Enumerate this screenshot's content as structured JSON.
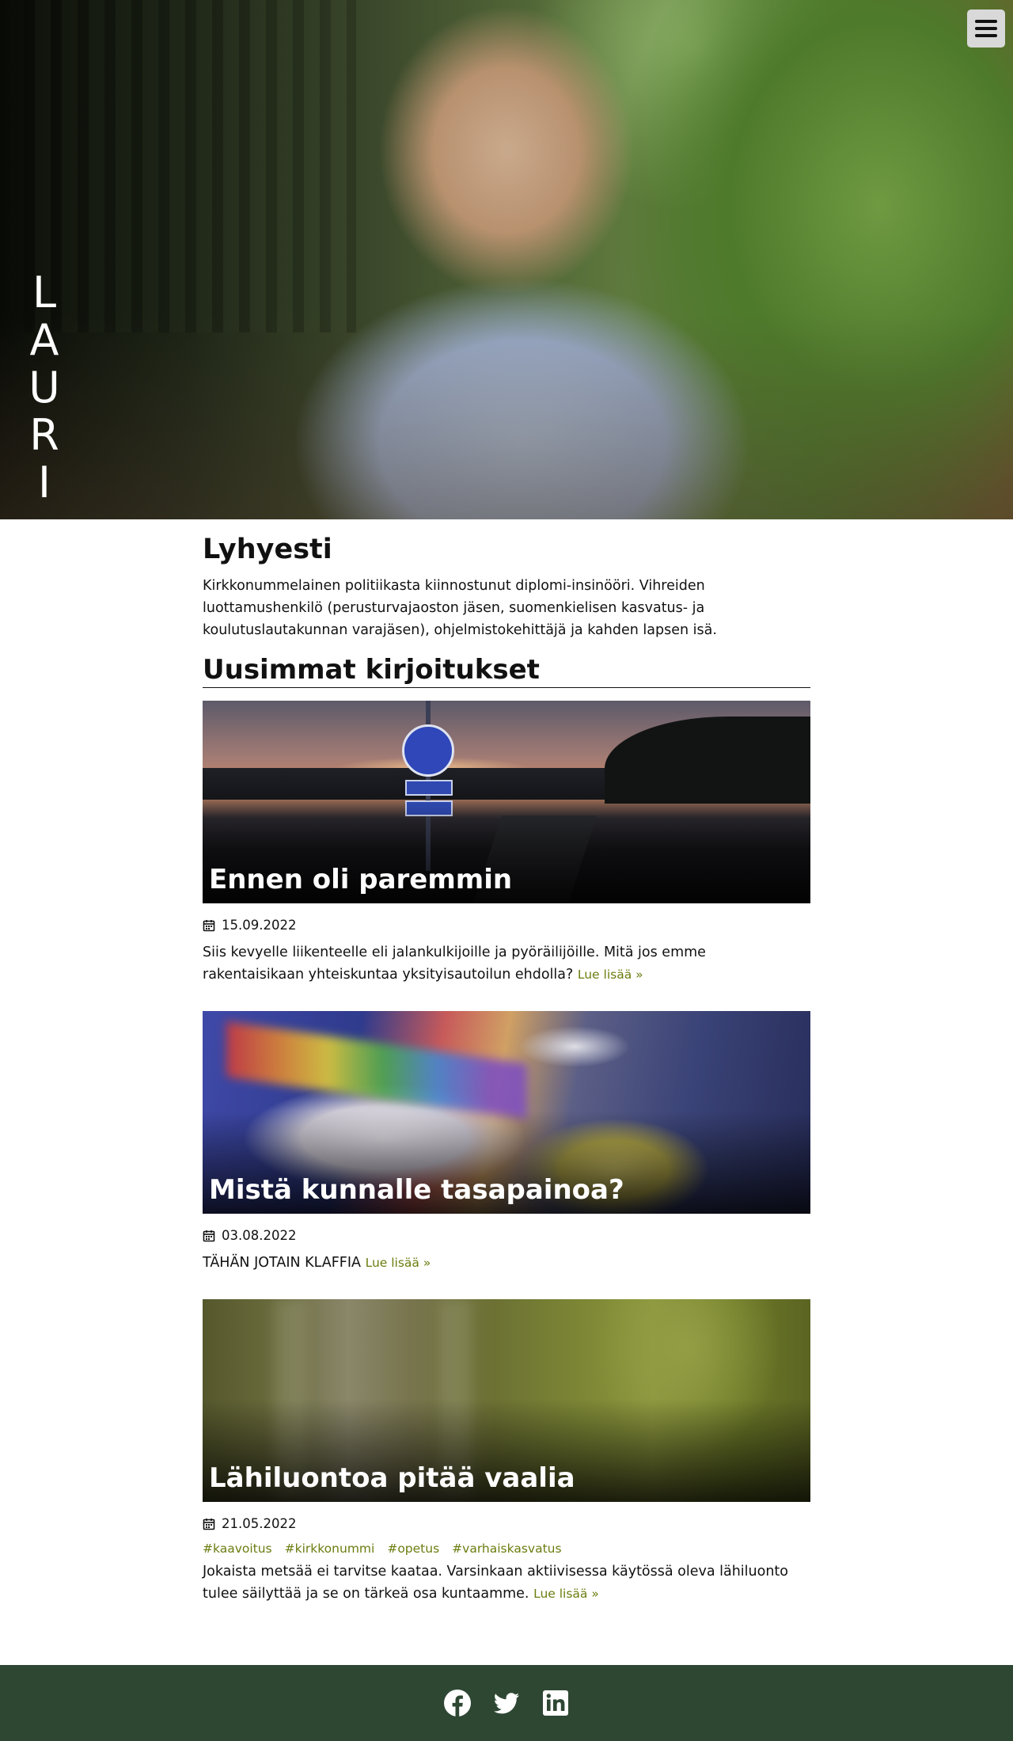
{
  "hero": {
    "name_letters": [
      "L",
      "A",
      "U",
      "R",
      "I"
    ],
    "menu_icon": "hamburger-menu-icon"
  },
  "about": {
    "title": "Lyhyesti",
    "text": "Kirkkonummelainen politiikasta kiinnostunut diplomi-insinööri. Vihreiden luottamushenkilö (perusturvajaoston jäsen, suomenkielisen kasvatus- ja koulutuslautakunnan varajäsen), ohjelmistokehittäjä ja kahden lapsen isä."
  },
  "posts_section": {
    "title": "Uusimmat kirjoitukset"
  },
  "posts": [
    {
      "title": "Ennen oli paremmin",
      "date": "15.09.2022",
      "tags": [],
      "excerpt": "Siis kevyelle liikenteelle eli jalankulkijoille ja pyöräilijöille. Mitä jos emme rakentaisikaan yhteiskuntaa yksityisautoilun ehdolla?",
      "read_more": "Lue lisää »"
    },
    {
      "title": "Mistä kunnalle tasapainoa?",
      "date": "03.08.2022",
      "tags": [],
      "excerpt": "TÄHÄN JOTAIN KLAFFIA",
      "read_more": "Lue lisää »"
    },
    {
      "title": "Lähiluontoa pitää vaalia",
      "date": "21.05.2022",
      "tags": [
        "#kaavoitus",
        "#kirkkonummi",
        "#opetus",
        "#varhaiskasvatus"
      ],
      "excerpt": "Jokaista metsää ei tarvitse kaataa. Varsinkaan aktiivisessa käytössä oleva lähiluonto tulee säilyttää ja se on tärkeä osa kuntaamme.",
      "read_more": "Lue lisää »"
    }
  ],
  "footer": {
    "social": [
      "facebook-icon",
      "twitter-icon",
      "linkedin-icon"
    ]
  },
  "colors": {
    "link": "#6b7d0f",
    "footer_bg": "#2e4733",
    "menu_button_bg": "#d9d9d9"
  }
}
